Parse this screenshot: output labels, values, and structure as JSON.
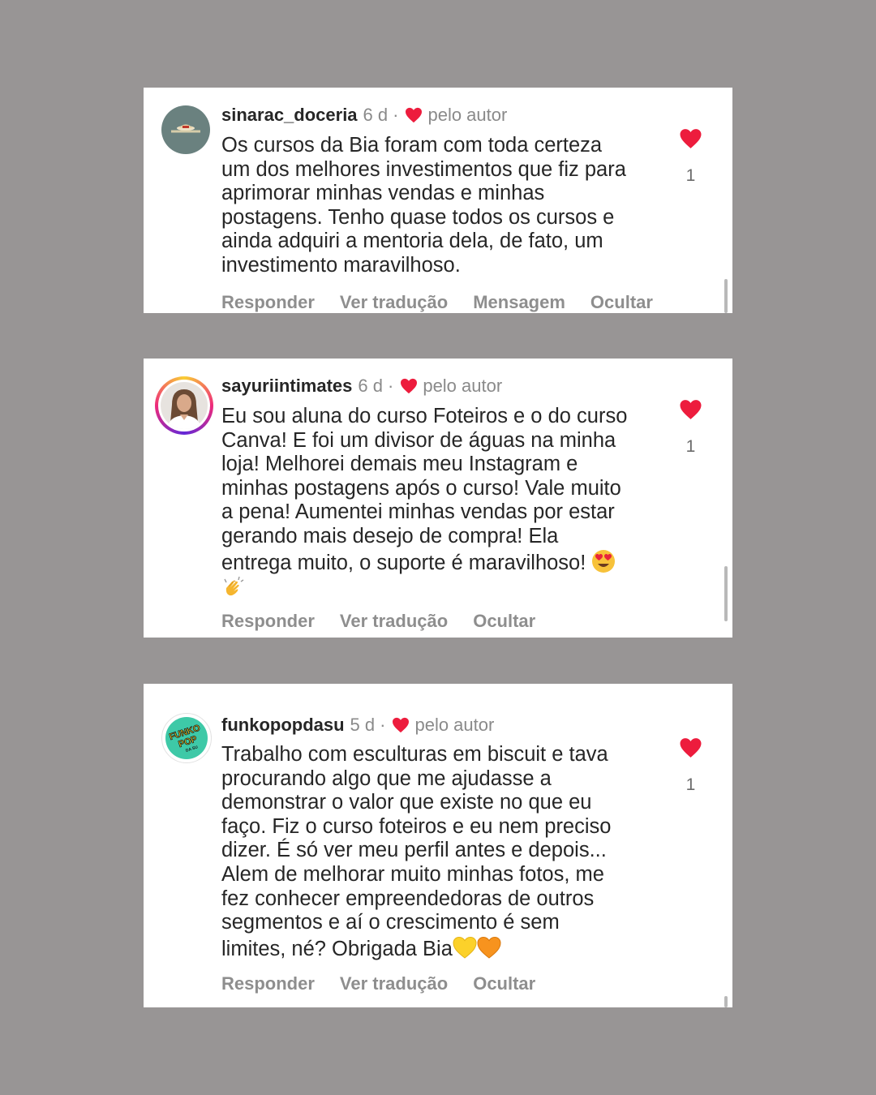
{
  "colors": {
    "background": "#989595",
    "card": "#ffffff",
    "heart": "#ed1c3d",
    "username": "#262626",
    "muted": "#8e8e8e"
  },
  "comments": [
    {
      "username": "sinarac_doceria",
      "time": "6 d",
      "separator": "·",
      "author_tag": "pelo autor",
      "text": "Os cursos da Bia foram com toda certeza\num dos melhores investimentos que fiz para\naprimorar minhas vendas e minhas\npostagens. Tenho quase todos os cursos e\nainda adquiri a mentoria dela, de fato, um\ninvestimento maravilhoso.",
      "likes": "1",
      "avatar_icon": "sinara-carvalho-logo-icon",
      "actions": [
        "Responder",
        "Ver tradução",
        "Mensagem",
        "Ocultar"
      ]
    },
    {
      "username": "sayuriintimates",
      "time": "6 d",
      "separator": "·",
      "author_tag": "pelo autor",
      "text": "Eu sou aluna do curso Foteiros e o do curso\nCanva! E foi um divisor de águas na minha\nloja! Melhorei demais meu Instagram e\nminhas postagens após o curso! Vale muito\na pena! Aumentei minhas vendas por estar\ngerando mais desejo de compra! Ela\nentrega muito, o suporte é maravilhoso! ",
      "emojis": [
        "heart-eyes-emoji-icon",
        "clapping-hands-emoji-icon"
      ],
      "likes": "1",
      "avatar_icon": "profile-photo-icon",
      "actions": [
        "Responder",
        "Ver tradução",
        "Ocultar"
      ]
    },
    {
      "username": "funkopopdasu",
      "time": "5 d",
      "separator": "·",
      "author_tag": "pelo autor",
      "text": "Trabalho com esculturas em biscuit e tava\nprocurando algo que me ajudasse a\ndemonstrar o valor que existe no que eu\nfaço. Fiz o curso foteiros e eu nem preciso\ndizer. É só ver meu perfil antes e depois...\nAlem de melhorar muito minhas fotos, me\nfez conhecer empreendedoras de outros\nsegmentos e aí o crescimento é sem\nlimites, né? Obrigada Bia",
      "emojis": [
        "yellow-heart-emoji-icon",
        "orange-heart-emoji-icon"
      ],
      "likes": "1",
      "avatar_icon": "funko-pop-logo-icon",
      "avatar_text": [
        "FUNKO",
        "POP",
        "DA SU"
      ],
      "actions": [
        "Responder",
        "Ver tradução",
        "Ocultar"
      ]
    }
  ]
}
